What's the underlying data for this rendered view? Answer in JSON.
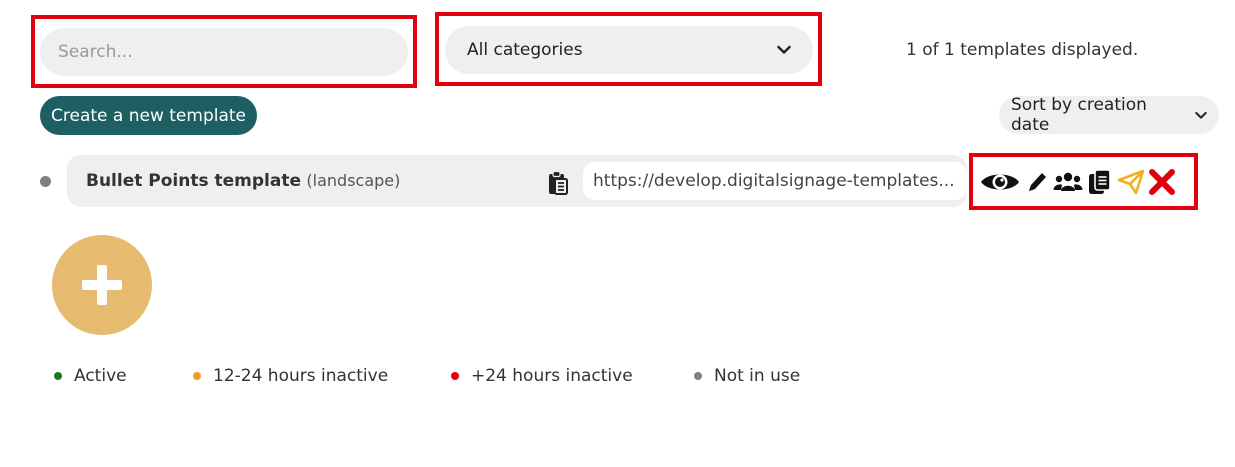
{
  "search": {
    "placeholder": "Search...",
    "value": ""
  },
  "category_filter": {
    "selected": "All categories"
  },
  "templates_count_text": "1 of 1 templates displayed.",
  "create_button_label": "Create a new template",
  "sort": {
    "selected": "Sort by creation date"
  },
  "templates": [
    {
      "name": "Bullet  Points template",
      "orientation": "(landscape)",
      "url": "https://develop.digitalsignage-templates...",
      "status_color": "#808080",
      "actions": [
        "eye-icon",
        "pencil-icon",
        "users-icon",
        "copy-icon",
        "send-icon",
        "delete-icon"
      ]
    }
  ],
  "legend": [
    {
      "label": "Active",
      "color": "#1a7a1a"
    },
    {
      "label": "12-24 hours inactive",
      "color": "#f0a020"
    },
    {
      "label": "+24 hours inactive",
      "color": "#e00010"
    },
    {
      "label": "Not in use",
      "color": "#808080"
    }
  ],
  "colors": {
    "highlight": "#e00010",
    "primary_button": "#1d5f63",
    "add_circle": "#e6bb6f",
    "send_icon": "#f0b020",
    "delete_icon": "#e00010"
  }
}
